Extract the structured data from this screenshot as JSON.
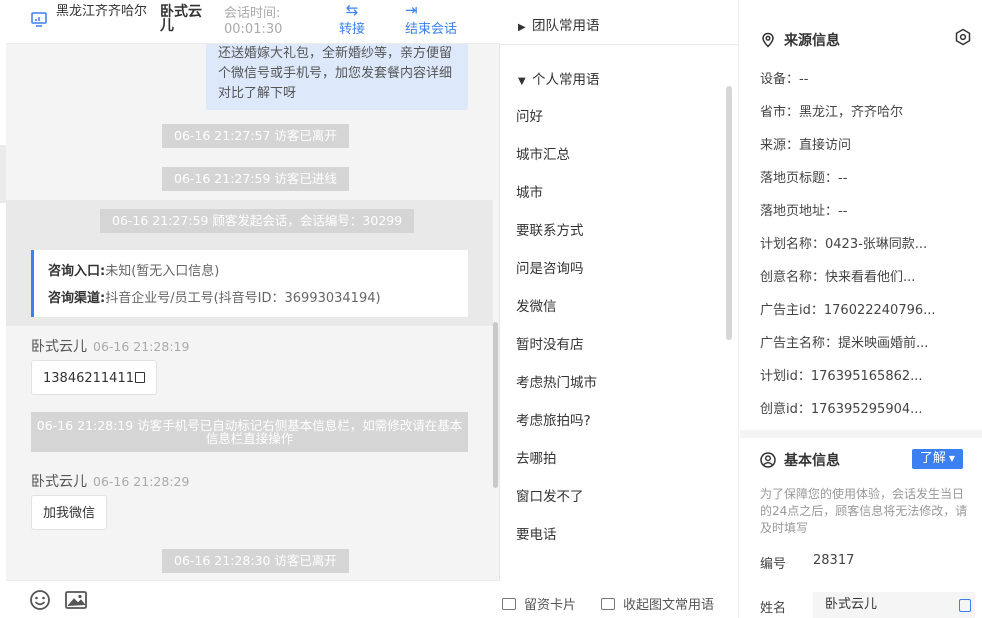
{
  "header": {
    "location": "黑龙江齐齐哈尔",
    "visitor_name": "卧式云儿",
    "session_time_label": "会话时间:",
    "session_time_value": "00:01:30",
    "transfer_label": "转接",
    "end_label": "结束会话"
  },
  "chat": {
    "top_bubble": "还送婚嫁大礼包，全新婚纱等，亲方便留个微信号或手机号，加您发套餐内容详细对比了解下呀",
    "system_events": [
      "06-16 21:27:57 访客已离开",
      "06-16 21:27:59 访客已进线",
      "06-16 21:27:59 顾客发起会话，会话编号：30299",
      "06-16 21:28:30 访客已离开"
    ],
    "entry": {
      "label": "咨询入口:",
      "value": "未知(暂无入口信息)"
    },
    "channel": {
      "label": "咨询渠道:",
      "value": "抖音企业号/员工号(抖音号ID：36993034194)"
    },
    "messages": [
      {
        "sender": "卧式云儿",
        "time": "06-16 21:28:19",
        "text": "13846211411"
      },
      {
        "sender": "卧式云儿",
        "time": "06-16 21:28:29",
        "text": "加我微信"
      }
    ],
    "notice": "06-16 21:28:19 访客手机号已自动标记右侧基本信息栏，如需修改请在基本信息栏直接操作"
  },
  "footer": {
    "emoji_icon": "smile-icon",
    "image_icon": "image-icon"
  },
  "phrases": {
    "team_group": "团队常用语",
    "personal_group": "个人常用语",
    "items": [
      "问好",
      "城市汇总",
      "城市",
      "要联系方式",
      "问是咨询吗",
      "发微信",
      "暂时没有店",
      "考虑热门城市",
      "考虑旅拍吗?",
      "去哪拍",
      "窗口发不了",
      "要电话"
    ],
    "leave_card": "留资卡片",
    "collapse_label": "收起图文常用语"
  },
  "source_info": {
    "title": "来源信息",
    "rows": [
      {
        "k": "设备：",
        "v": "--"
      },
      {
        "k": "省市：",
        "v": "黑龙江，齐齐哈尔"
      },
      {
        "k": "来源：",
        "v": "直接访问"
      },
      {
        "k": "落地页标题：",
        "v": "--"
      },
      {
        "k": "落地页地址：",
        "v": "--"
      },
      {
        "k": "计划名称：",
        "v": "0423-张琳同款..."
      },
      {
        "k": "创意名称：",
        "v": "快来看看他们..."
      },
      {
        "k": "广告主id：",
        "v": "176022240796..."
      },
      {
        "k": "广告主名称：",
        "v": "提米映画婚前..."
      },
      {
        "k": "计划id：",
        "v": "176395165862..."
      },
      {
        "k": "创意id：",
        "v": "176395295904..."
      }
    ]
  },
  "basic_info": {
    "title": "基本信息",
    "learn_label": "了解",
    "hint": "为了保障您的使用体验，会话发生当日的24点之后，顾客信息将无法修改，请及时填写",
    "id_label": "编号",
    "id_value": "28317",
    "name_label": "姓名",
    "name_value": "卧式云儿"
  },
  "colors": {
    "accent": "#3b7ff0",
    "bubble": "#dde9fb",
    "system_pill": "#d5d5d5"
  }
}
